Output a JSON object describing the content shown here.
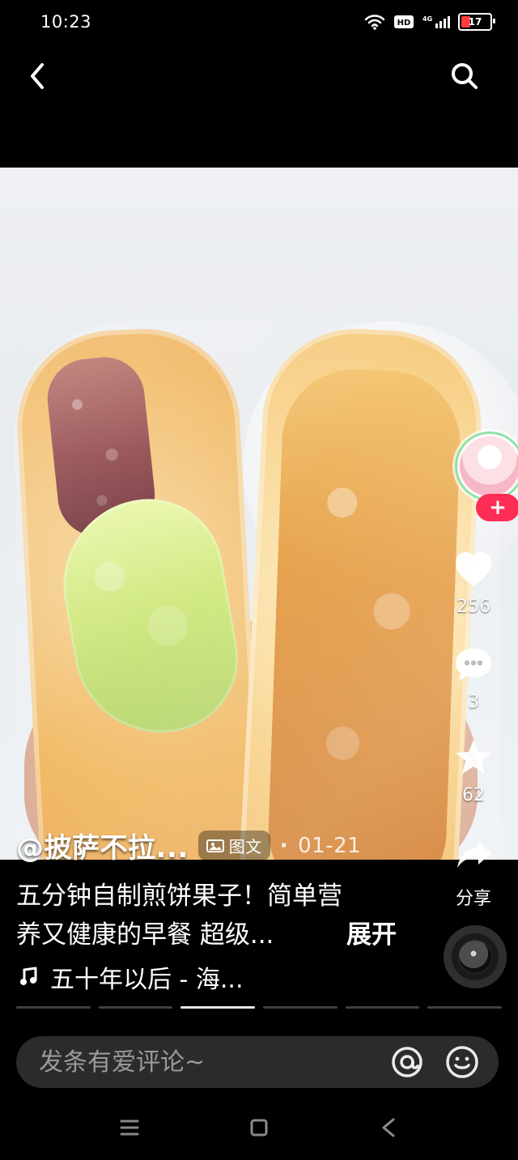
{
  "status_bar": {
    "time": "10:23",
    "battery_percent": "17"
  },
  "post": {
    "author": "@披萨不拉...",
    "type_label": "图文",
    "date": "01-21",
    "description_line1": "五分钟自制煎饼果子！简单营",
    "description_line2": "养又健康的早餐 超级...",
    "expand_label": "展开",
    "music_label": "五十年以后 - 海..."
  },
  "right_rail": {
    "like_count": "256",
    "comment_count": "3",
    "favorite_count": "62",
    "share_label": "分享"
  },
  "progress": {
    "segments": 6,
    "active_index": 2
  },
  "comment_bar": {
    "placeholder": "发条有爱评论~"
  },
  "icons": {
    "back": "back-icon",
    "search": "search-icon",
    "like": "heart-icon",
    "comment": "comment-icon",
    "favorite": "star-icon",
    "share": "share-icon",
    "music": "music-note-icon",
    "mention": "at-icon",
    "emoji": "emoji-icon"
  },
  "colors": {
    "accent": "#ff2d55",
    "background": "#000000"
  }
}
